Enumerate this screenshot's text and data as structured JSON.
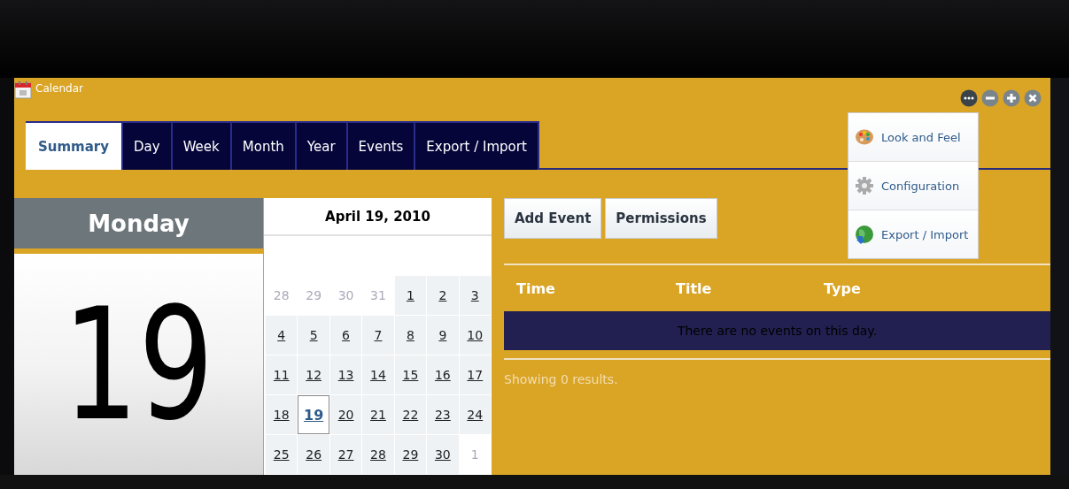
{
  "window": {
    "title": "Calendar",
    "controls": [
      {
        "kind": "more",
        "selected": true
      },
      {
        "kind": "minimize",
        "selected": false
      },
      {
        "kind": "maximize",
        "selected": false
      },
      {
        "kind": "close",
        "selected": false
      }
    ]
  },
  "tabs": [
    {
      "label": "Summary",
      "selected": true
    },
    {
      "label": "Day",
      "selected": false
    },
    {
      "label": "Week",
      "selected": false
    },
    {
      "label": "Month",
      "selected": false
    },
    {
      "label": "Year",
      "selected": false
    },
    {
      "label": "Events",
      "selected": false
    },
    {
      "label": "Export / Import",
      "selected": false
    }
  ],
  "menu": [
    {
      "label": "Look and Feel",
      "kind": "palette"
    },
    {
      "label": "Configuration",
      "kind": "gear"
    },
    {
      "label": "Export / Import",
      "kind": "globe"
    }
  ],
  "day_card": {
    "weekday": "Monday",
    "day": "19"
  },
  "mini_calendar": {
    "title": "April 19, 2010",
    "weeks": [
      [
        {
          "day": "28",
          "in_month": false,
          "selected": false
        },
        {
          "day": "29",
          "in_month": false,
          "selected": false
        },
        {
          "day": "30",
          "in_month": false,
          "selected": false
        },
        {
          "day": "31",
          "in_month": false,
          "selected": false
        },
        {
          "day": "1",
          "in_month": true,
          "selected": false
        },
        {
          "day": "2",
          "in_month": true,
          "selected": false
        },
        {
          "day": "3",
          "in_month": true,
          "selected": false
        }
      ],
      [
        {
          "day": "4",
          "in_month": true,
          "selected": false
        },
        {
          "day": "5",
          "in_month": true,
          "selected": false
        },
        {
          "day": "6",
          "in_month": true,
          "selected": false
        },
        {
          "day": "7",
          "in_month": true,
          "selected": false
        },
        {
          "day": "8",
          "in_month": true,
          "selected": false
        },
        {
          "day": "9",
          "in_month": true,
          "selected": false
        },
        {
          "day": "10",
          "in_month": true,
          "selected": false
        }
      ],
      [
        {
          "day": "11",
          "in_month": true,
          "selected": false
        },
        {
          "day": "12",
          "in_month": true,
          "selected": false
        },
        {
          "day": "13",
          "in_month": true,
          "selected": false
        },
        {
          "day": "14",
          "in_month": true,
          "selected": false
        },
        {
          "day": "15",
          "in_month": true,
          "selected": false
        },
        {
          "day": "16",
          "in_month": true,
          "selected": false
        },
        {
          "day": "17",
          "in_month": true,
          "selected": false
        }
      ],
      [
        {
          "day": "18",
          "in_month": true,
          "selected": false
        },
        {
          "day": "19",
          "in_month": true,
          "selected": true
        },
        {
          "day": "20",
          "in_month": true,
          "selected": false
        },
        {
          "day": "21",
          "in_month": true,
          "selected": false
        },
        {
          "day": "22",
          "in_month": true,
          "selected": false
        },
        {
          "day": "23",
          "in_month": true,
          "selected": false
        },
        {
          "day": "24",
          "in_month": true,
          "selected": false
        }
      ],
      [
        {
          "day": "25",
          "in_month": true,
          "selected": false
        },
        {
          "day": "26",
          "in_month": true,
          "selected": false
        },
        {
          "day": "27",
          "in_month": true,
          "selected": false
        },
        {
          "day": "28",
          "in_month": true,
          "selected": false
        },
        {
          "day": "29",
          "in_month": true,
          "selected": false
        },
        {
          "day": "30",
          "in_month": true,
          "selected": false
        },
        {
          "day": "1",
          "in_month": false,
          "selected": false
        }
      ]
    ]
  },
  "buttons": [
    "Add Event",
    "Permissions"
  ],
  "events_table": {
    "columns": [
      "Time",
      "Title",
      "Type"
    ],
    "empty_message": "There are no events on this day.",
    "footer": "Showing 0 results."
  }
}
